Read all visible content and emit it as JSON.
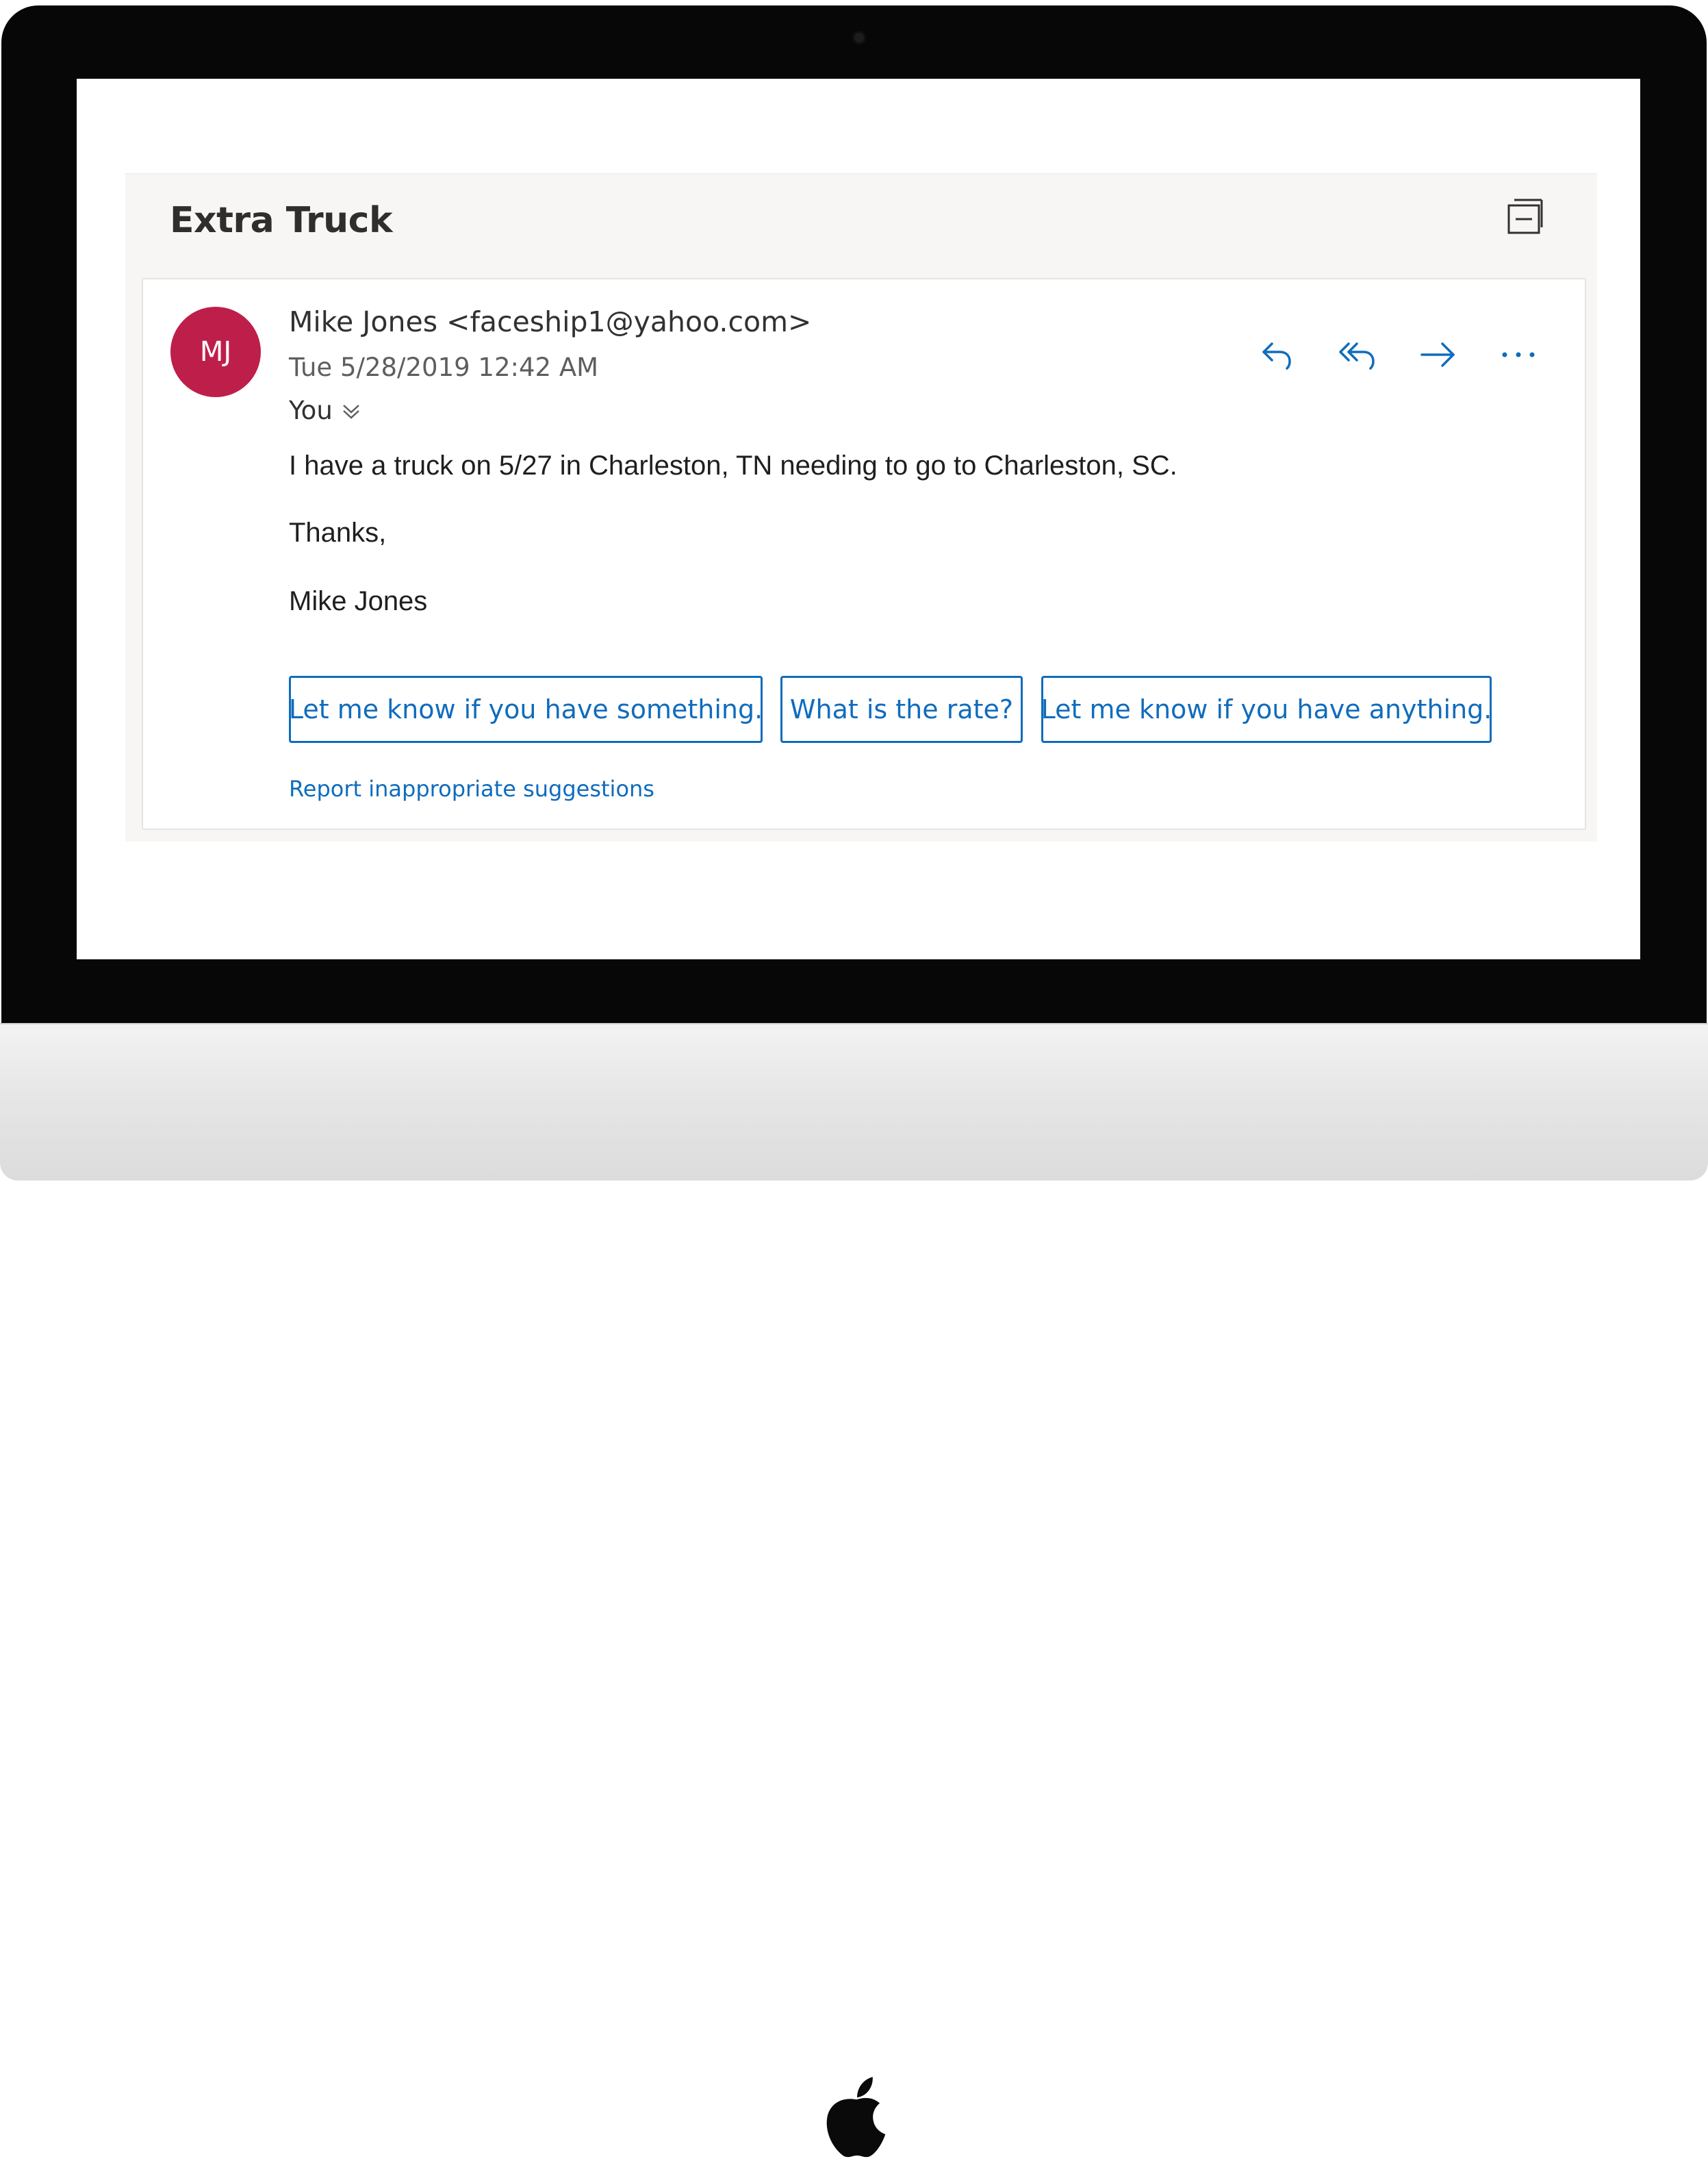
{
  "email": {
    "subject": "Extra Truck",
    "sender": {
      "initials": "MJ",
      "name_and_address": "Mike Jones <faceship1@yahoo.com>",
      "avatar_color": "#be1f4a"
    },
    "timestamp": "Tue 5/28/2019 12:42 AM",
    "recipients": "You",
    "body": {
      "line1": "I have a truck on 5/27 in Charleston, TN needing to go to Charleston, SC.",
      "line2": "Thanks,",
      "line3": "Mike Jones"
    },
    "actions": [
      "reply-icon",
      "reply-all-icon",
      "forward-icon",
      "more-actions-icon"
    ],
    "suggested_replies": [
      "Let me know if you have something.",
      "What is the rate?",
      "Let me know if you have anything."
    ],
    "report_link": "Report inappropriate suggestions"
  },
  "colors": {
    "accent": "#0f6cbd",
    "avatar": "#be1f4a",
    "pane_background": "#f7f6f5"
  }
}
